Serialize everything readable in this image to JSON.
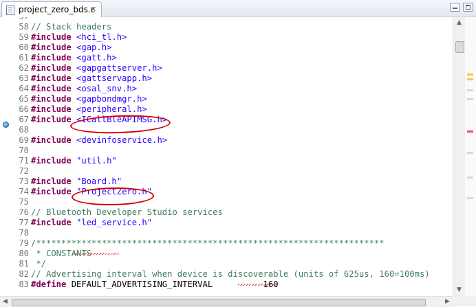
{
  "tab": {
    "title": "project_zero_bds.c",
    "close": "✕"
  },
  "lines": [
    {
      "n": "57",
      "tokens": []
    },
    {
      "n": "58",
      "tokens": [
        {
          "c": "cm",
          "t": "// Stack headers"
        }
      ]
    },
    {
      "n": "59",
      "tokens": [
        {
          "c": "kw",
          "t": "#include"
        },
        {
          "c": "",
          "t": " "
        },
        {
          "c": "str",
          "t": "<hci_tl.h>"
        }
      ]
    },
    {
      "n": "60",
      "tokens": [
        {
          "c": "kw",
          "t": "#include"
        },
        {
          "c": "",
          "t": " "
        },
        {
          "c": "str",
          "t": "<gap.h>"
        }
      ]
    },
    {
      "n": "61",
      "tokens": [
        {
          "c": "kw",
          "t": "#include"
        },
        {
          "c": "",
          "t": " "
        },
        {
          "c": "str",
          "t": "<gatt.h>"
        }
      ]
    },
    {
      "n": "62",
      "tokens": [
        {
          "c": "kw",
          "t": "#include"
        },
        {
          "c": "",
          "t": " "
        },
        {
          "c": "str",
          "t": "<gapgattserver.h>"
        }
      ]
    },
    {
      "n": "63",
      "tokens": [
        {
          "c": "kw",
          "t": "#include"
        },
        {
          "c": "",
          "t": " "
        },
        {
          "c": "str",
          "t": "<gattservapp.h>"
        }
      ]
    },
    {
      "n": "64",
      "tokens": [
        {
          "c": "kw",
          "t": "#include"
        },
        {
          "c": "",
          "t": " "
        },
        {
          "c": "str",
          "t": "<osal_snv.h>"
        }
      ]
    },
    {
      "n": "65",
      "tokens": [
        {
          "c": "kw",
          "t": "#include"
        },
        {
          "c": "",
          "t": " "
        },
        {
          "c": "str",
          "t": "<gapbondmgr.h>"
        }
      ]
    },
    {
      "n": "66",
      "tokens": [
        {
          "c": "kw",
          "t": "#include"
        },
        {
          "c": "",
          "t": " "
        },
        {
          "c": "str",
          "t": "<peripheral.h>"
        }
      ]
    },
    {
      "n": "67",
      "tokens": [
        {
          "c": "kw",
          "t": "#include"
        },
        {
          "c": "",
          "t": " "
        },
        {
          "c": "str",
          "t": "<ICallBleAPIMSG.h>"
        }
      ]
    },
    {
      "n": "68",
      "tokens": []
    },
    {
      "n": "69",
      "tokens": [
        {
          "c": "kw",
          "t": "#include"
        },
        {
          "c": "",
          "t": " "
        },
        {
          "c": "str",
          "t": "<devinfoservice.h>"
        }
      ]
    },
    {
      "n": "70",
      "tokens": []
    },
    {
      "n": "71",
      "tokens": [
        {
          "c": "kw",
          "t": "#include"
        },
        {
          "c": "",
          "t": " "
        },
        {
          "c": "str",
          "t": "\"util.h\""
        }
      ]
    },
    {
      "n": "72",
      "tokens": []
    },
    {
      "n": "73",
      "tokens": [
        {
          "c": "kw",
          "t": "#include"
        },
        {
          "c": "",
          "t": " "
        },
        {
          "c": "str",
          "t": "\"Board.h\""
        }
      ]
    },
    {
      "n": "74",
      "tokens": [
        {
          "c": "kw",
          "t": "#include"
        },
        {
          "c": "",
          "t": " "
        },
        {
          "c": "str",
          "t": "\"ProjectZero.h\""
        }
      ]
    },
    {
      "n": "75",
      "tokens": []
    },
    {
      "n": "76",
      "tokens": [
        {
          "c": "cm",
          "t": "// Bluetooth Developer Studio services"
        }
      ]
    },
    {
      "n": "77",
      "tokens": [
        {
          "c": "kw",
          "t": "#include"
        },
        {
          "c": "",
          "t": " "
        },
        {
          "c": "str",
          "t": "\"led_service.h\""
        }
      ]
    },
    {
      "n": "78",
      "tokens": []
    },
    {
      "n": "79",
      "tokens": [
        {
          "c": "cm",
          "t": "/*********************************************************************"
        }
      ]
    },
    {
      "n": "80",
      "tokens": [
        {
          "c": "cm",
          "t": " * CONSTANTS"
        }
      ]
    },
    {
      "n": "81",
      "tokens": [
        {
          "c": "cm",
          "t": " */"
        }
      ]
    },
    {
      "n": "82",
      "tokens": [
        {
          "c": "cm",
          "t": "// Advertising interval when device is discoverable (units of 625us, 160=100ms)"
        }
      ]
    },
    {
      "n": "83",
      "tokens": [
        {
          "c": "kw",
          "t": "#define"
        },
        {
          "c": "",
          "t": " DEFAULT_ADVERTISING_INTERVAL          160"
        }
      ]
    }
  ],
  "colors": {
    "keyword": "#7f0055",
    "string": "#2a00ff",
    "comment": "#3f7f5f",
    "line_number": "#787878",
    "annotation": "#d20000"
  },
  "overview_marks": [
    {
      "color": "#f2c94c"
    },
    {
      "color": "#f2c94c"
    },
    {
      "color": "#d8d8d8"
    },
    {
      "color": "#d8d8d8"
    },
    {
      "color": "#e7478b"
    },
    {
      "color": "#d8d8d8"
    },
    {
      "color": "#d8d8d8"
    },
    {
      "color": "#d8d8d8"
    }
  ],
  "icons": {
    "file": "c-file-icon",
    "breakpoint": "breakpoint-icon",
    "minimize": "minimize-icon",
    "maximize": "maximize-icon"
  }
}
